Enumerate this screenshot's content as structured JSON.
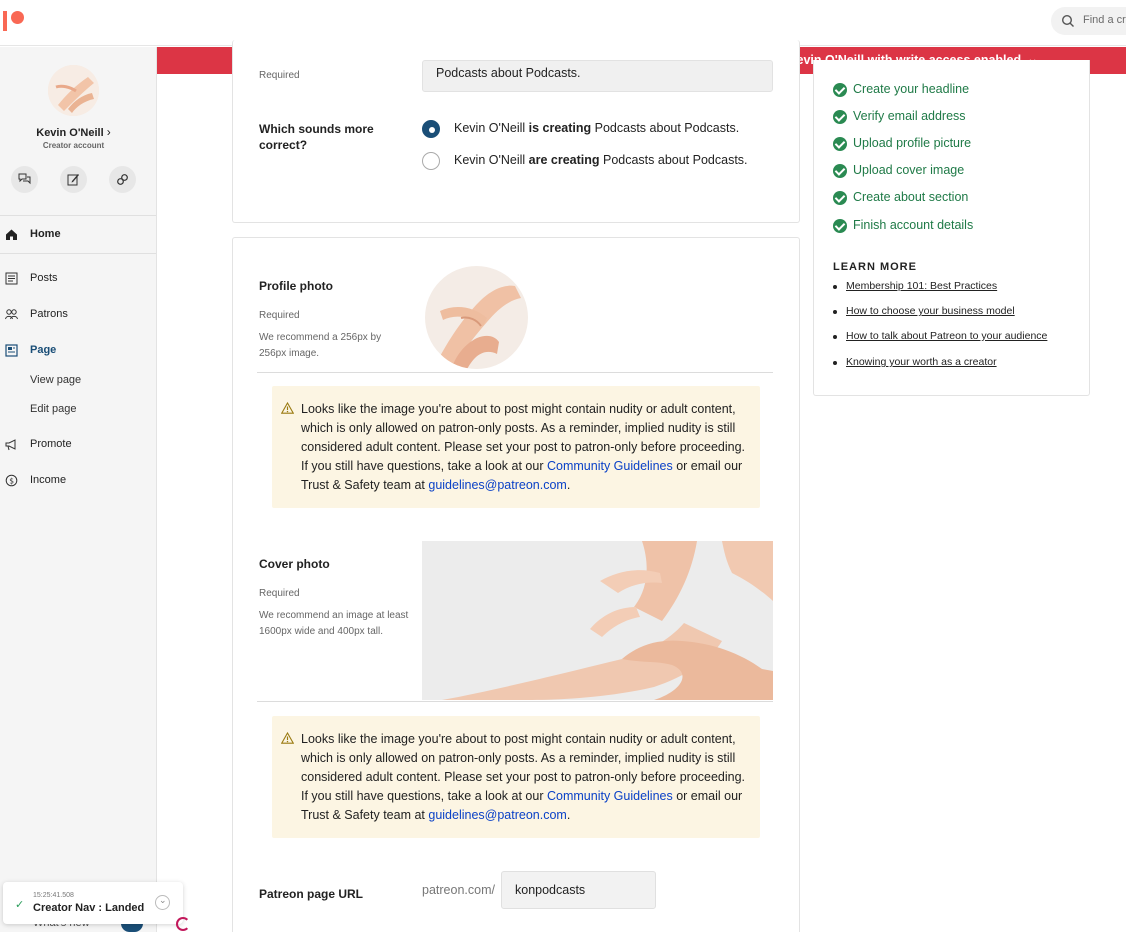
{
  "topbar": {
    "search_placeholder": "Find a cr"
  },
  "banner": {
    "text": "Impersonating Kevin O'Neill with write access enabled",
    "color": "#dc3545"
  },
  "sidebar": {
    "creator_name": "Kevin O'Neill",
    "creator_caret": "›",
    "creator_sub": "Creator account",
    "action_icons": [
      "chat-icon",
      "edit-icon",
      "link-icon"
    ],
    "nav": [
      {
        "label": "Home",
        "icon": "home-icon"
      },
      {
        "label": "Posts",
        "icon": "posts-icon"
      },
      {
        "label": "Patrons",
        "icon": "patrons-icon"
      },
      {
        "label": "Page",
        "icon": "page-icon",
        "active": true
      },
      {
        "label": "Promote",
        "icon": "promote-icon"
      },
      {
        "label": "Income",
        "icon": "income-icon"
      }
    ],
    "page_sub": [
      "View page",
      "Edit page"
    ],
    "whats_new": "What's new"
  },
  "toast": {
    "time": "15:25:41.508",
    "title": "Creator Nav : Landed"
  },
  "form": {
    "required_top": "Required",
    "top_input_partial": "Podcasts about Podcasts.",
    "grammar_label": "Which sounds more correct?",
    "grammar_options": [
      {
        "name": "Kevin O'Neill ",
        "verb": "is creating",
        "rest": " Podcasts about Podcasts.",
        "selected": true
      },
      {
        "name": "Kevin O'Neill ",
        "verb": "are creating",
        "rest": " Podcasts about Podcasts.",
        "selected": false
      }
    ],
    "profile_photo": {
      "label": "Profile photo",
      "required": "Required",
      "hint": "We recommend a 256px by 256px image."
    },
    "warning": {
      "text_before": "Looks like the image you're about to post might contain nudity or adult content, which is only allowed on patron-only posts. As a reminder, implied nudity is still considered adult content. Please set your post to patron-only before proceeding. If you still have questions, take a look at our ",
      "link1": "Community Guidelines",
      "text_mid": " or email our Trust & Safety team at ",
      "link2": "guidelines@patreon.com",
      "text_end": "."
    },
    "cover_photo": {
      "label": "Cover photo",
      "required": "Required",
      "hint": "We recommend an image at least 1600px wide and 400px tall."
    },
    "url": {
      "label": "Patreon page URL",
      "prefix": "patreon.com/",
      "value": "konpodcasts"
    }
  },
  "checklist": {
    "items": [
      "Create your headline",
      "Verify email address",
      "Upload profile picture",
      "Upload cover image",
      "Create about section",
      "Finish account details"
    ],
    "color": "#1f7a47"
  },
  "learn_more": {
    "title": "LEARN MORE",
    "links": [
      "Membership 101: Best Practices",
      "How to choose your business model",
      "How to talk about Patreon to your audience",
      "Knowing your worth as a creator"
    ]
  }
}
